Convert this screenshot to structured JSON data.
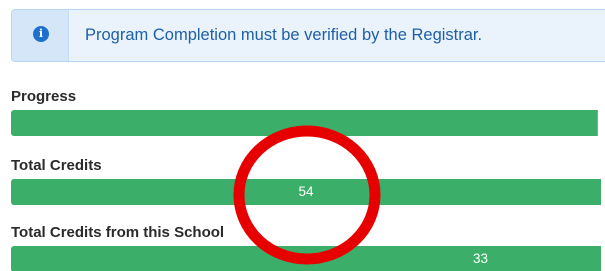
{
  "alert": {
    "icon": "info-circle-icon",
    "icon_glyph": "i",
    "text": "Program Completion must be verified by the Registrar."
  },
  "progress": {
    "label": "Progress",
    "fill_fraction": 1.0,
    "value_text": ""
  },
  "total_credits": {
    "label": "Total Credits",
    "fill_fraction": 1.0,
    "value_text": "54"
  },
  "school_credits": {
    "label": "Total Credits from this School",
    "fill_fraction": 1.0,
    "value_text": "33"
  },
  "colors": {
    "bar_fill": "#3baf6a",
    "alert_text": "#1f5fa8",
    "annotation_circle": "#e60000"
  }
}
